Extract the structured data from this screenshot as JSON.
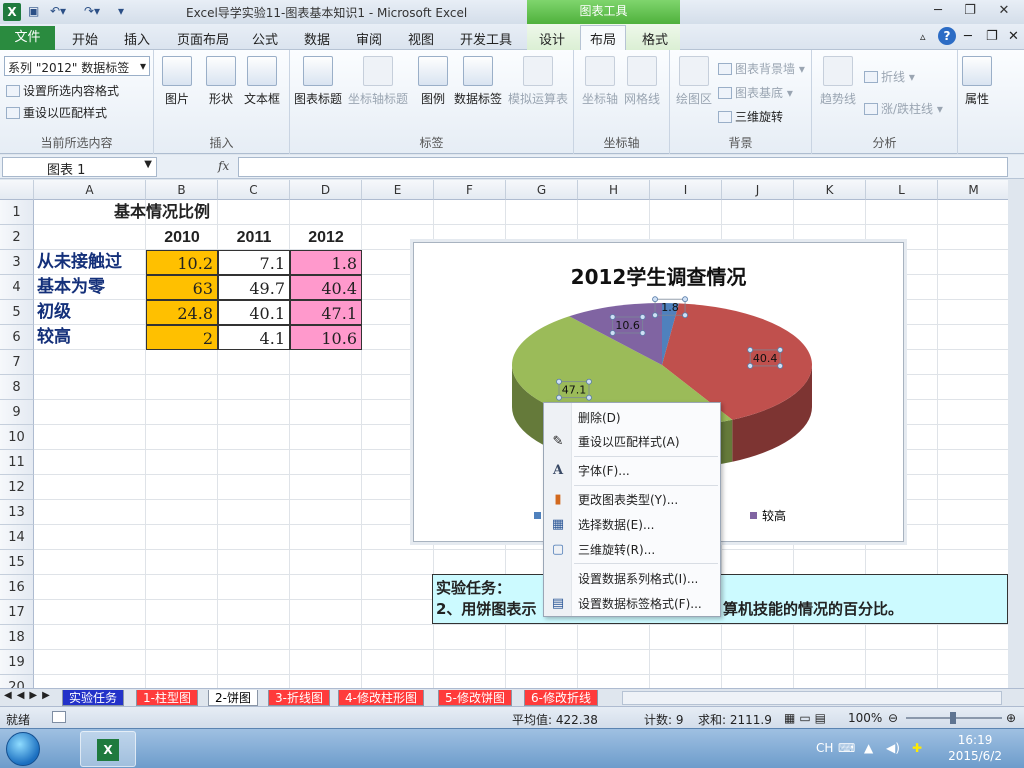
{
  "window": {
    "title": "Excel导学实验11-图表基本知识1  -  Microsoft Excel",
    "chart_tools": "图表工具",
    "qa_icons": [
      "save-icon",
      "undo-icon",
      "redo-icon"
    ]
  },
  "tabs": {
    "file": "文件",
    "items": [
      "开始",
      "插入",
      "页面布局",
      "公式",
      "数据",
      "审阅",
      "视图",
      "开发工具",
      "设计",
      "布局",
      "格式"
    ],
    "active": "布局"
  },
  "ribbon": {
    "selection_combo": "系列 \"2012\" 数据标签",
    "format_selection": "设置所选内容格式",
    "reset_style": "重设以匹配样式",
    "group_current": "当前所选内容",
    "picture": "图片",
    "shapes": "形状",
    "textbox": "文本框",
    "group_insert": "插入",
    "chart_title": "图表标题",
    "axis_title": "坐标轴标题",
    "legend": "图例",
    "data_labels": "数据标签",
    "data_table": "模拟运算表",
    "group_labels": "标签",
    "axes": "坐标轴",
    "gridlines": "网格线",
    "group_axes": "坐标轴",
    "plot_area": "绘图区",
    "chart_wall": "图表背景墙",
    "chart_floor": "图表基底",
    "rotation_3d": "三维旋转",
    "group_background": "背景",
    "trendline": "趋势线",
    "lines": "折线",
    "updown_bars": "涨/跌柱线",
    "group_analysis": "分析",
    "properties": "属性"
  },
  "formula_bar": {
    "name_box": "图表 1",
    "fx": "fx",
    "value": ""
  },
  "grid": {
    "columns": [
      "A",
      "B",
      "C",
      "D",
      "E",
      "F",
      "G",
      "H",
      "I",
      "J",
      "K",
      "L",
      "M"
    ],
    "rows": [
      "1",
      "2",
      "3",
      "4",
      "5",
      "6",
      "7",
      "8",
      "9",
      "10",
      "11",
      "12",
      "13",
      "14",
      "15",
      "16",
      "17",
      "18",
      "19",
      "20"
    ],
    "table_title": "基本情况比例",
    "years": [
      "2010",
      "2011",
      "2012"
    ],
    "row_labels": [
      "从未接触过",
      "基本为零",
      "初级",
      "较高"
    ],
    "values": [
      [
        "10.2",
        "7.1",
        "1.8"
      ],
      [
        "63",
        "49.7",
        "40.4"
      ],
      [
        "24.8",
        "40.1",
        "47.1"
      ],
      [
        "2",
        "4.1",
        "10.6"
      ]
    ],
    "colors": {
      "col_2010": "#ffc000",
      "col_2011": "#ffffff",
      "col_2012": "#ff99cc"
    }
  },
  "chart_data": {
    "type": "pie",
    "title": "2012学生调查情况",
    "categories": [
      "从未接触过",
      "基本为零",
      "初级",
      "较高"
    ],
    "values": [
      1.8,
      40.4,
      47.1,
      10.6
    ],
    "colors": [
      "#4f81bd",
      "#c0504d",
      "#9bbb59",
      "#8064a2"
    ],
    "data_labels": [
      "1.8",
      "40.4",
      "47.1",
      "10.6"
    ],
    "legend_visible": [
      "级",
      "较高"
    ],
    "legend_position": "bottom"
  },
  "task": {
    "line1": "实验任务：",
    "line2_left": "2、用饼图表示",
    "line2_right": "算机技能的情况的百分比。"
  },
  "context_menu": {
    "items": [
      {
        "label": "删除(D)",
        "icon": ""
      },
      {
        "label": "重设以匹配样式(A)",
        "icon": "reset-style-icon"
      },
      {
        "label": "字体(F)...",
        "icon": "font-icon"
      },
      {
        "label": "更改图表类型(Y)...",
        "icon": "chart-type-icon"
      },
      {
        "label": "选择数据(E)...",
        "icon": "select-data-icon"
      },
      {
        "label": "三维旋转(R)...",
        "icon": "rotation-3d-icon"
      },
      {
        "label": "设置数据系列格式(I)...",
        "icon": ""
      },
      {
        "label": "设置数据标签格式(F)...",
        "icon": "format-label-icon"
      }
    ]
  },
  "sheet_tabs": [
    "实验任务",
    "1-柱型图",
    "2-饼图",
    "3-折线图",
    "4-修改柱形图",
    "5-修改饼图",
    "6-修改折线"
  ],
  "status": {
    "ready": "就绪",
    "average": "平均值: 422.38",
    "count": "计数: 9",
    "sum": "求和: 2111.9",
    "zoom": "100%"
  },
  "taskbar": {
    "lang": "CH",
    "time": "16:19",
    "date": "2015/6/2"
  }
}
